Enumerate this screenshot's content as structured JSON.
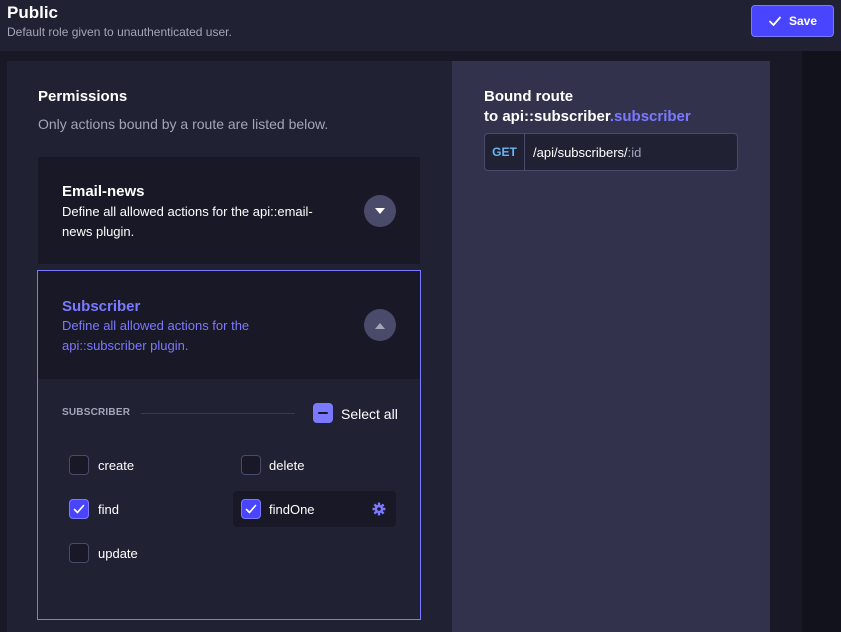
{
  "header": {
    "title": "Public",
    "subtitle": "Default role given to unauthenticated user.",
    "save_label": "Save"
  },
  "permissions": {
    "title": "Permissions",
    "subtitle": "Only actions bound by a route are listed below.",
    "plugins": [
      {
        "name": "Email-news",
        "description": "Define all allowed actions for the api::email-news plugin.",
        "expanded": false
      },
      {
        "name": "Subscriber",
        "description": "Define all allowed actions for the api::subscriber plugin.",
        "expanded": true,
        "section_label": "SUBSCRIBER",
        "select_all_label": "Select all",
        "select_all_state": "indeterminate",
        "actions": [
          {
            "label": "create",
            "checked": false
          },
          {
            "label": "delete",
            "checked": false
          },
          {
            "label": "find",
            "checked": true
          },
          {
            "label": "findOne",
            "checked": true,
            "highlighted": true
          },
          {
            "label": "update",
            "checked": false
          }
        ]
      }
    ]
  },
  "bound_route": {
    "title_line1": "Bound route",
    "title_prefix": "to api::subscriber",
    "title_highlight": ".subscriber",
    "method": "GET",
    "path": "/api/subscribers/",
    "path_param": ":id"
  },
  "colors": {
    "accent": "#7b79ff",
    "primary_button": "#4945ff",
    "method_get": "#66b7f1"
  },
  "icons": {
    "save": "check-icon",
    "collapsed": "chevron-down-icon",
    "expanded": "chevron-up-icon",
    "select_all": "minus-icon",
    "checked": "check-icon",
    "settings": "gear-icon"
  }
}
